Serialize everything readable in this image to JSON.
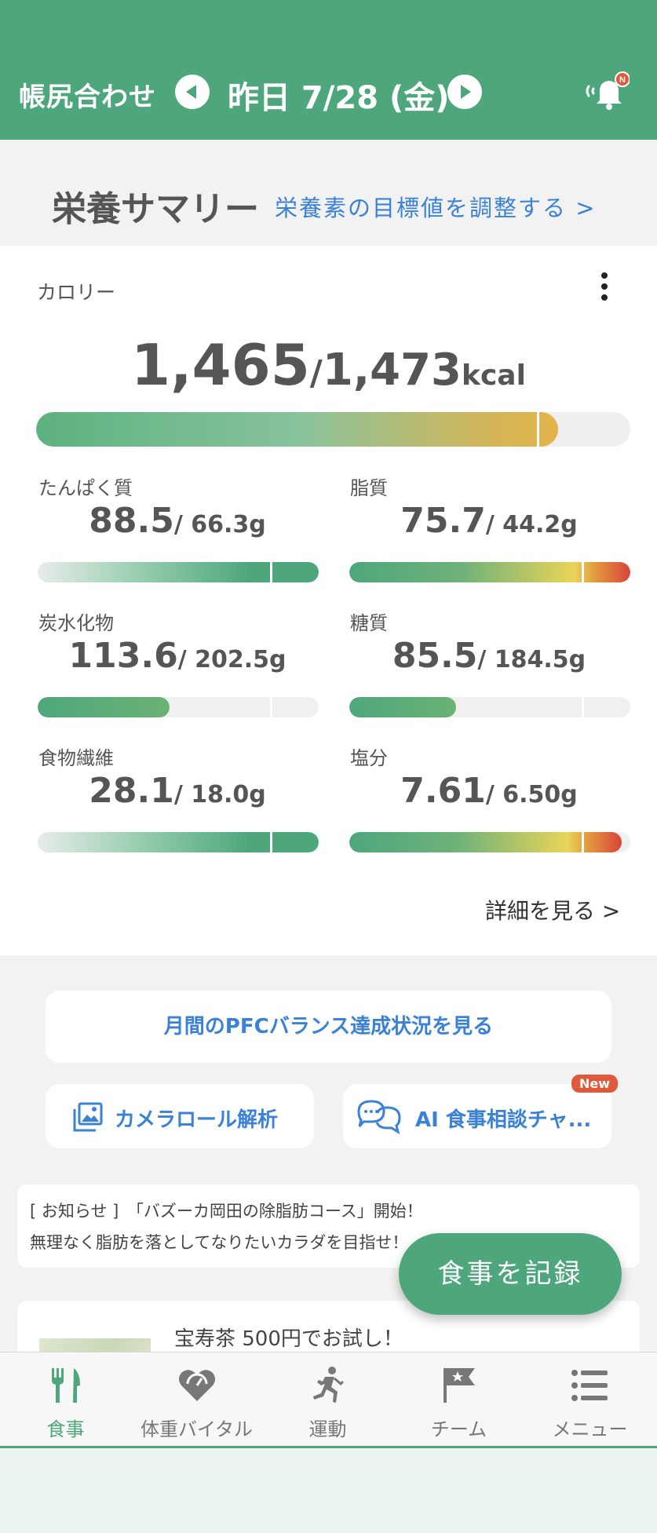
{
  "header": {
    "left_label": "帳尻合わせ",
    "date": "昨日 7/28 (金)",
    "bell_badge": "N"
  },
  "summary": {
    "title": "栄養サマリー",
    "adjust_link": "栄養素の目標値を調整する >"
  },
  "calorie": {
    "label": "カロリー",
    "value": "1,465",
    "separator": "/",
    "target": "1,473",
    "unit": "kcal",
    "progress": 0.98
  },
  "nutrients": [
    {
      "label": "たんぱく質",
      "value": "88.5",
      "target": "/ 66.3g",
      "progress": 1.0,
      "style": "over"
    },
    {
      "label": "脂質",
      "value": "75.7",
      "target": "/ 44.2g",
      "progress": 1.0,
      "style": "warn"
    },
    {
      "label": "炭水化物",
      "value": "113.6",
      "target": "/ 202.5g",
      "progress": 0.47,
      "style": "under"
    },
    {
      "label": "糖質",
      "value": "85.5",
      "target": "/ 184.5g",
      "progress": 0.38,
      "style": "under"
    },
    {
      "label": "食物繊維",
      "value": "28.1",
      "target": "/ 18.0g",
      "progress": 1.0,
      "style": "over"
    },
    {
      "label": "塩分",
      "value": "7.61",
      "target": "/ 6.50g",
      "progress": 0.97,
      "style": "warn"
    }
  ],
  "detail_link": "詳細を見る >",
  "pfc_button": "月間のPFCバランス達成状況を見る",
  "camera_button": "カメラロール解析",
  "ai_button": "AI 食事相談チャ...",
  "new_badge": "New",
  "notice": {
    "line1": "[ お知らせ ]　「バズーカ岡田の除脂肪コース」開始！",
    "line2": "無理なく脂肪を落としてなりたいカラダを目指せ！"
  },
  "promo": {
    "text": "宝寿茶 500円でお試し！"
  },
  "fab": "食事を記録",
  "tabs": [
    {
      "label": "食事",
      "icon": "fork-knife-icon",
      "active": true
    },
    {
      "label": "体重バイタル",
      "icon": "heart-scale-icon",
      "active": false
    },
    {
      "label": "運動",
      "icon": "running-icon",
      "active": false
    },
    {
      "label": "チーム",
      "icon": "flag-star-icon",
      "active": false
    },
    {
      "label": "メニュー",
      "icon": "list-icon",
      "active": false
    }
  ],
  "colors": {
    "primary": "#4ea77c",
    "link": "#3b82d6",
    "warning": "#d9443a",
    "new_badge": "#df5a3a"
  }
}
